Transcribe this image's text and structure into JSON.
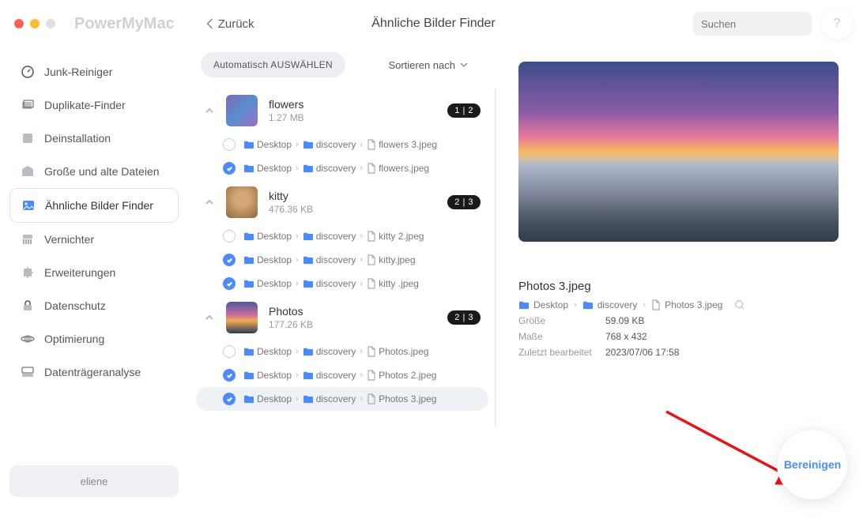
{
  "app_name": "PowerMyMac",
  "back_label": "Zurück",
  "page_title": "Ähnliche Bilder Finder",
  "search_placeholder": "Suchen",
  "help_label": "?",
  "sidebar": {
    "items": [
      {
        "label": "Junk-Reiniger",
        "icon": "gauge"
      },
      {
        "label": "Duplikate-Finder",
        "icon": "folders"
      },
      {
        "label": "Deinstallation",
        "icon": "app"
      },
      {
        "label": "Große und alte Dateien",
        "icon": "box"
      },
      {
        "label": "Ähnliche Bilder Finder",
        "icon": "image",
        "active": true
      },
      {
        "label": "Vernichter",
        "icon": "shredder"
      },
      {
        "label": "Erweiterungen",
        "icon": "puzzle"
      },
      {
        "label": "Datenschutz",
        "icon": "lock"
      },
      {
        "label": "Optimierung",
        "icon": "planet"
      },
      {
        "label": "Datenträgeranalyse",
        "icon": "disk"
      }
    ],
    "user": "eliene"
  },
  "toolbar": {
    "auto_select": "Automatisch AUSWÄHLEN",
    "sort_label": "Sortieren nach"
  },
  "groups": [
    {
      "name": "flowers",
      "size": "1.27 MB",
      "badge": "1 | 2",
      "thumb": "flowers",
      "files": [
        {
          "checked": false,
          "path": [
            "Desktop",
            "discovery"
          ],
          "file": "flowers 3.jpeg"
        },
        {
          "checked": true,
          "path": [
            "Desktop",
            "discovery"
          ],
          "file": "flowers.jpeg"
        }
      ]
    },
    {
      "name": "kitty",
      "size": "476.36 KB",
      "badge": "2 | 3",
      "thumb": "kitty",
      "files": [
        {
          "checked": false,
          "path": [
            "Desktop",
            "discovery"
          ],
          "file": "kitty 2.jpeg"
        },
        {
          "checked": true,
          "path": [
            "Desktop",
            "discovery"
          ],
          "file": "kitty.jpeg"
        },
        {
          "checked": true,
          "path": [
            "Desktop",
            "discovery"
          ],
          "file": "kitty .jpeg"
        }
      ]
    },
    {
      "name": "Photos",
      "size": "177.26 KB",
      "badge": "2 | 3",
      "thumb": "sunset",
      "files": [
        {
          "checked": false,
          "path": [
            "Desktop",
            "discovery"
          ],
          "file": "Photos.jpeg"
        },
        {
          "checked": true,
          "path": [
            "Desktop",
            "discovery"
          ],
          "file": "Photos 2.jpeg"
        },
        {
          "checked": true,
          "path": [
            "Desktop",
            "discovery"
          ],
          "file": "Photos 3.jpeg",
          "selected": true
        }
      ]
    }
  ],
  "detail": {
    "filename": "Photos 3.jpeg",
    "path": [
      "Desktop",
      "discovery",
      "Photos 3.jpeg"
    ],
    "meta": {
      "size_k": "Größe",
      "size_v": "59.09 KB",
      "dim_k": "Maße",
      "dim_v": "768 x 432",
      "mod_k": "Zuletzt bearbeitet",
      "mod_v": "2023/07/06 17:58"
    }
  },
  "clean_label": "Bereinigen"
}
